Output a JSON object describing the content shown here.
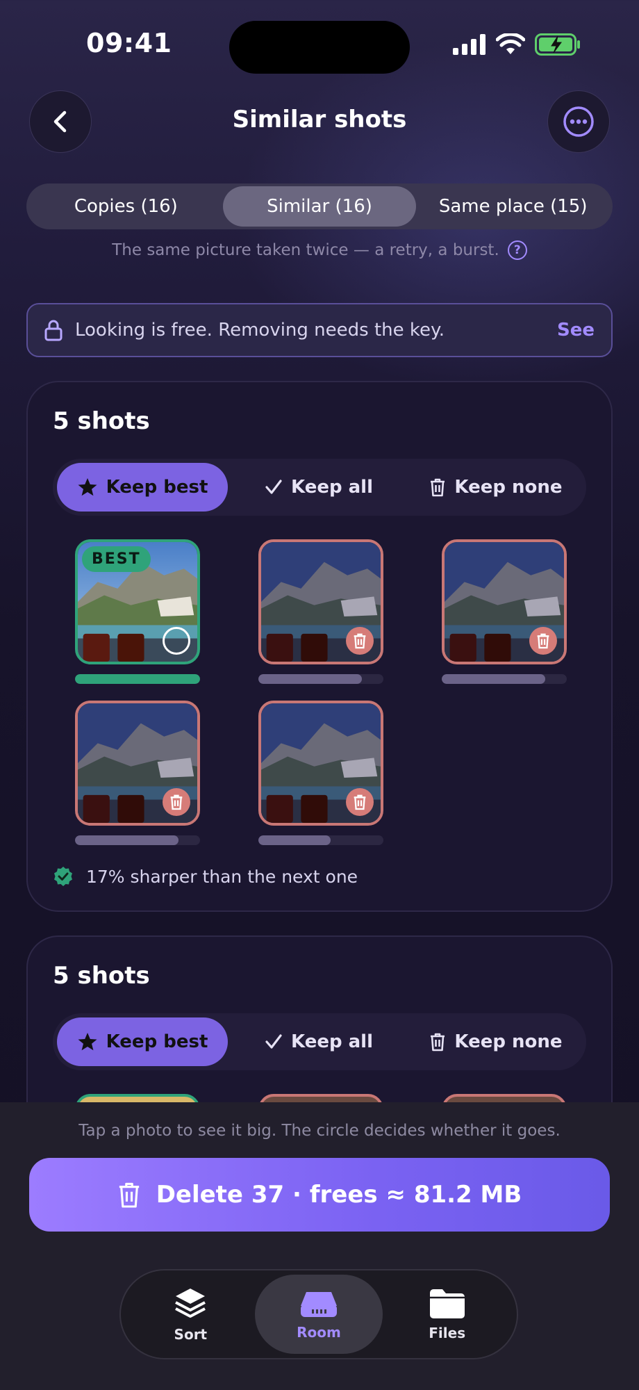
{
  "status_bar": {
    "time": "09:41"
  },
  "header": {
    "title": "Similar shots"
  },
  "tabs": [
    {
      "label": "Copies (16)",
      "active": false
    },
    {
      "label": "Similar (16)",
      "active": true
    },
    {
      "label": "Same place (15)",
      "active": false
    }
  ],
  "tab_description": "The same picture taken twice — a retry, a burst.",
  "banner": {
    "text": "Looking is free. Removing needs the key.",
    "action": "See"
  },
  "groups": [
    {
      "title": "5 shots",
      "choices": [
        {
          "label": "Keep best",
          "icon": "star-icon",
          "active": true
        },
        {
          "label": "Keep all",
          "icon": "check-icon",
          "active": false
        },
        {
          "label": "Keep none",
          "icon": "trash-icon",
          "active": false
        }
      ],
      "best_badge": "BEST",
      "photos": [
        {
          "state": "keep",
          "sharpness": 1.0
        },
        {
          "state": "delete",
          "sharpness": 0.83
        },
        {
          "state": "delete",
          "sharpness": 0.83
        },
        {
          "state": "delete",
          "sharpness": 0.83
        },
        {
          "state": "delete",
          "sharpness": 0.58
        }
      ],
      "note": "17% sharper than the next one"
    },
    {
      "title": "5 shots",
      "choices": [
        {
          "label": "Keep best",
          "icon": "star-icon",
          "active": true
        },
        {
          "label": "Keep all",
          "icon": "check-icon",
          "active": false
        },
        {
          "label": "Keep none",
          "icon": "trash-icon",
          "active": false
        }
      ]
    }
  ],
  "bottom": {
    "hint": "Tap a photo to see it big. The circle decides whether it goes.",
    "delete_label": "Delete 37 · frees ≈ 81.2 MB"
  },
  "nav": [
    {
      "label": "Sort",
      "icon": "layers-icon",
      "active": false
    },
    {
      "label": "Room",
      "icon": "drive-icon",
      "active": true
    },
    {
      "label": "Files",
      "icon": "folder-icon",
      "active": false
    }
  ],
  "colors": {
    "accent": "#a28bff",
    "keep": "#2fa37a",
    "delete": "#d67c78"
  }
}
